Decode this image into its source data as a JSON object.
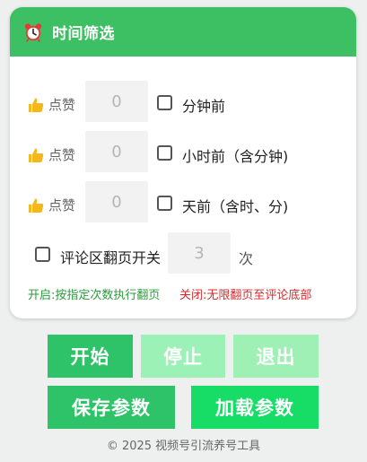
{
  "header": {
    "title": "时间筛选",
    "icon": "alarm-clock-icon"
  },
  "rows": [
    {
      "label": "点赞",
      "value": "0",
      "option": "分钟前"
    },
    {
      "label": "点赞",
      "value": "0",
      "option": "小时前（含分钟)"
    },
    {
      "label": "点赞",
      "value": "0",
      "option": "天前（含时、分)"
    }
  ],
  "comment": {
    "label": "评论区翻页开关",
    "value": "3",
    "unit": "次"
  },
  "hints": {
    "on": "开启:按指定次数执行翻页",
    "off": "关闭:无限翻页至评论底部"
  },
  "buttons": {
    "start": "开始",
    "stop": "停止",
    "exit": "退出",
    "save": "保存参数",
    "load": "加载参数"
  },
  "footer": "© 2025 视频号引流养号工具",
  "colors": {
    "header": "#3dbf64",
    "start": "#2ec368",
    "stop_disabled": "#9cf2b6",
    "exit_disabled": "#9ff0b5",
    "save": "#2ec368",
    "load": "#17dc65",
    "hint_on": "#2a9b3a",
    "hint_off": "#d62a2a"
  }
}
